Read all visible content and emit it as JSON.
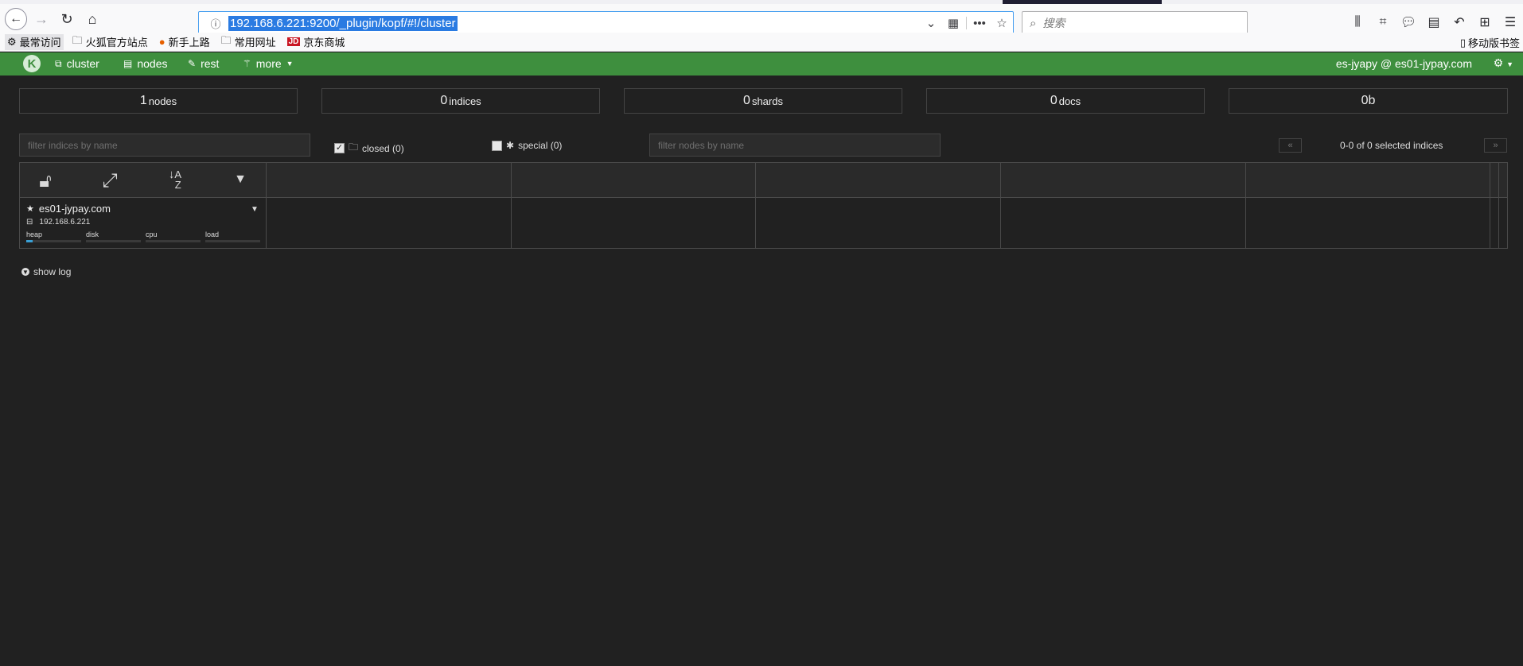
{
  "browser": {
    "url": "192.168.6.221:9200/_plugin/kopf/#!/cluster",
    "search_placeholder": "搜索",
    "bookmarks": [
      {
        "label": "最常访问",
        "icon": "gear-icon"
      },
      {
        "label": "火狐官方站点",
        "icon": "folder-icon"
      },
      {
        "label": "新手上路",
        "icon": "firefox-icon"
      },
      {
        "label": "常用网址",
        "icon": "folder-icon"
      },
      {
        "label": "京东商城",
        "icon": "jd-icon"
      }
    ],
    "mobile_bookmarks": "移动版书签"
  },
  "app": {
    "logo_letter": "K",
    "nav": [
      {
        "label": "cluster",
        "icon": "sitemap-icon"
      },
      {
        "label": "nodes",
        "icon": "server-icon"
      },
      {
        "label": "rest",
        "icon": "edit-icon"
      },
      {
        "label": "more",
        "icon": "wand-icon"
      }
    ],
    "user": "es-jyapy @ es01-jypay.com"
  },
  "stats": [
    {
      "value": "1",
      "label": "nodes"
    },
    {
      "value": "0",
      "label": "indices"
    },
    {
      "value": "0",
      "label": "shards"
    },
    {
      "value": "0",
      "label": "docs"
    },
    {
      "value": "0b",
      "label": ""
    }
  ],
  "filters": {
    "indices_placeholder": "filter indices by name",
    "closed_label": "closed (0)",
    "closed_checked": true,
    "special_label": "special (0)",
    "special_checked": false,
    "nodes_placeholder": "filter nodes by name",
    "pager_prev": "«",
    "pager_next": "»",
    "pager_text": "0-0 of 0 selected indices"
  },
  "node": {
    "name": "es01-jypay.com",
    "ip": "192.168.6.221",
    "metrics": [
      {
        "label": "heap",
        "fraction": 0.12
      },
      {
        "label": "disk",
        "fraction": 0.0
      },
      {
        "label": "cpu",
        "fraction": 0.0
      },
      {
        "label": "load",
        "fraction": 0.0
      }
    ]
  },
  "show_log": "show log",
  "colors": {
    "accent_green": "#3e8f3e",
    "background": "#212121",
    "url_highlight": "#2a7be2",
    "metric_bar": "#3aa0d5"
  }
}
